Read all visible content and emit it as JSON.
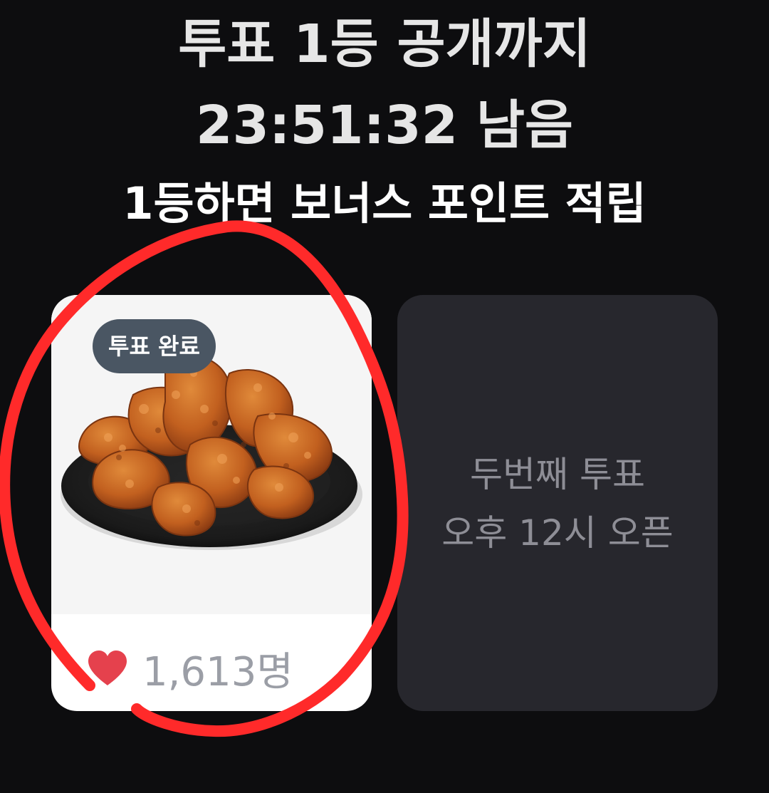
{
  "header": {
    "line1": "투표 1등 공개까지",
    "line2": "23:51:32 남음",
    "line3": "1등하면 보너스 포인트 적립"
  },
  "vote_card": {
    "badge": "투표 완료",
    "image": "fried-chicken-plate",
    "icon": "heart-icon",
    "vote_count": "1,613명",
    "accent_color": "#e5414d"
  },
  "next_card": {
    "line1": "두번째 투표",
    "line2": "오후 12시 오픈"
  },
  "annotation": {
    "type": "red-hand-drawn-circle",
    "color": "#ff2a2a"
  }
}
